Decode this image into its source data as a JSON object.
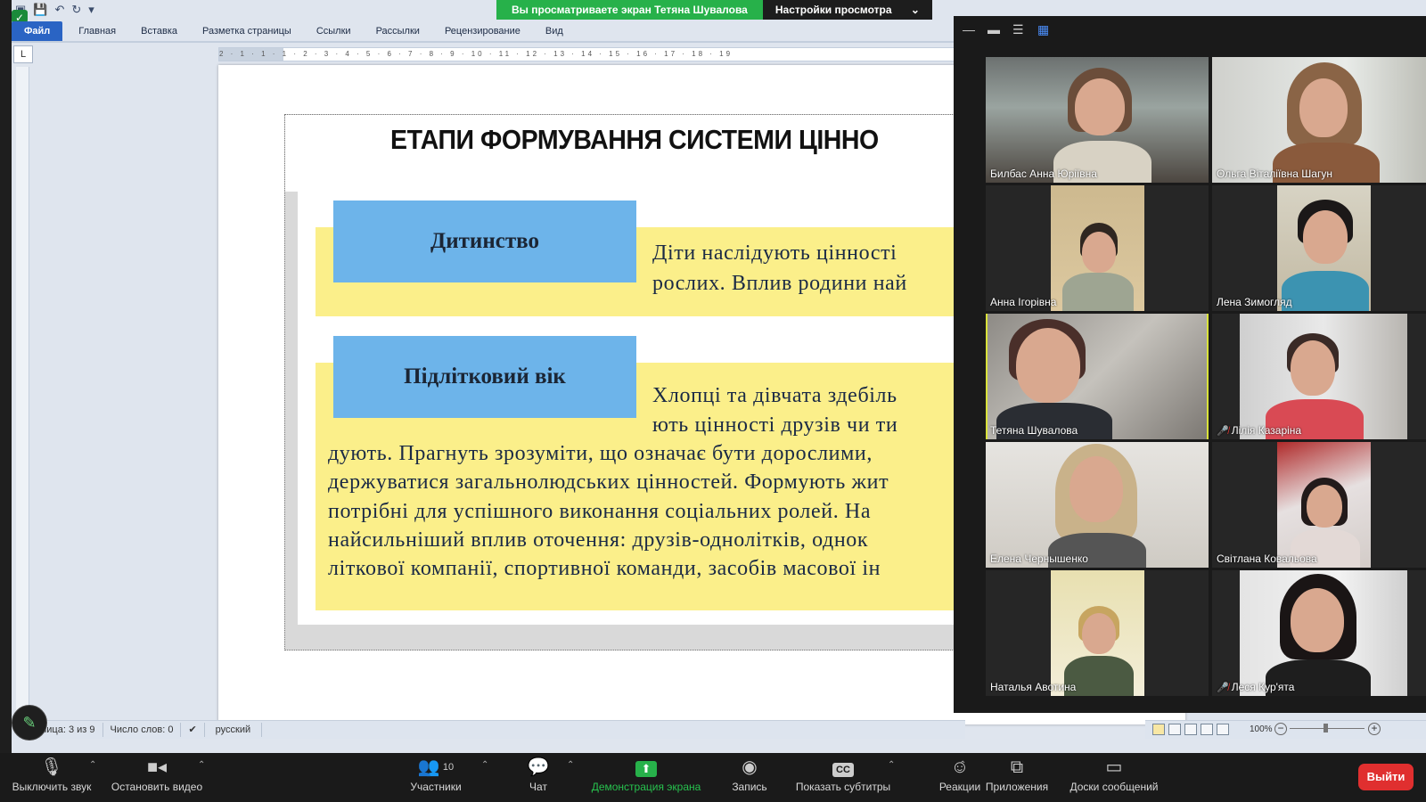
{
  "banner": {
    "viewing_text": "Вы просматриваете экран Тетяна Шувалова",
    "view_options_label": "Настройки просмотра"
  },
  "word": {
    "ribbon_tabs": [
      "Файл",
      "Главная",
      "Вставка",
      "Разметка страницы",
      "Ссылки",
      "Рассылки",
      "Рецензирование",
      "Вид"
    ],
    "ruler_text": "2 · 1 · 1 · 1 · 2 · 3 · 4 · 5 · 6 · 7 · 8 · 9 · 10 · 11 · 12 · 13 · 14 · 15 · 16 · 17 · 18 · 19",
    "status": {
      "page": "Страница: 3 из 9",
      "words": "Число слов: 0",
      "language": "русский",
      "zoom": "100%"
    }
  },
  "slide": {
    "title": "ЕТАПИ ФОРМУВАННЯ СИСТЕМИ ЦІННО",
    "stage1_label": "Дитинство",
    "stage1_lines": [
      "Діти наслідують цінності",
      "рослих. Вплив родини най"
    ],
    "stage2_label": "Підлітковий вік",
    "stage2_lines": [
      "Хлопці та дівчата здебіль",
      "ють цінності друзів чи ти",
      "дують. Прагнуть зрозуміти, що означає бути дорослими,",
      "держуватися загальнолюдських цінностей. Формують жит",
      "потрібні для успішного виконання соціальних ролей. На",
      "найсильніший вплив оточення: друзів-однолітків, однок",
      "літкової компанії, спортивної команди, засобів масової ін"
    ]
  },
  "gallery": {
    "participants": [
      {
        "name": "Билбас Анна Юріївна",
        "muted": false,
        "speaking": false
      },
      {
        "name": "Ольга Віталіївна Шагун",
        "muted": false,
        "speaking": false
      },
      {
        "name": "Анна Ігорівна",
        "muted": false,
        "speaking": false
      },
      {
        "name": "Лена Зимогляд",
        "muted": false,
        "speaking": false
      },
      {
        "name": "Тетяна Шувалова",
        "muted": false,
        "speaking": true
      },
      {
        "name": "Лілія Казаріна",
        "muted": true,
        "speaking": false
      },
      {
        "name": "Елена Чернышенко",
        "muted": false,
        "speaking": false
      },
      {
        "name": "Світлана Ковальова",
        "muted": false,
        "speaking": false
      },
      {
        "name": "Наталья Авотина",
        "muted": false,
        "speaking": false
      },
      {
        "name": "Леся Кур'ята",
        "muted": true,
        "speaking": false
      }
    ]
  },
  "toolbar": {
    "mute_label": "Выключить звук",
    "video_label": "Остановить видео",
    "participants_label": "Участники",
    "participants_count": "10",
    "chat_label": "Чат",
    "share_label": "Демонстрация экрана",
    "record_label": "Запись",
    "captions_label": "Показать субтитры",
    "captions_icon_text": "CC",
    "reactions_label": "Реакции",
    "apps_label": "Приложения",
    "whiteboard_label": "Доски сообщений",
    "leave_label": "Выйти"
  },
  "colors": {
    "banner_green": "#27b14a",
    "leave_red": "#e02f2f",
    "speaker_highlight": "#d9e23a",
    "slide_yellow": "#fbef8a",
    "slide_blue": "#6db4ea"
  }
}
